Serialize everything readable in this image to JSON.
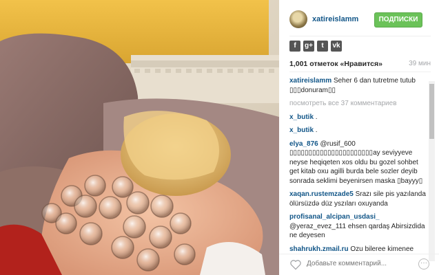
{
  "post": {
    "username": "xatireislamm",
    "follow_label": "ПОДПИСКИ",
    "likes_text": "1,001 отметок «Нравится»",
    "time_text": "39 мин",
    "view_all": "посмотреть все 37 комментариев",
    "add_comment_placeholder": "Добавьте комментарий...",
    "more_label": "···"
  },
  "share_icons": [
    {
      "name": "facebook-icon",
      "glyph": "f"
    },
    {
      "name": "google-plus-icon",
      "glyph": "g+"
    },
    {
      "name": "tumblr-icon",
      "glyph": "t"
    },
    {
      "name": "vk-icon",
      "glyph": "vk"
    }
  ],
  "caption": {
    "user": "xatireislamm",
    "text": "Seher 6 dan tutretme tutub ▯▯▯donuram▯▯"
  },
  "comments": [
    {
      "user": "x_butik",
      "text": "."
    },
    {
      "user": "x_butik",
      "text": "."
    },
    {
      "user": "elya_876",
      "text": "@rusif_600 ▯▯▯▯▯▯▯▯▯▯▯▯▯▯▯▯▯▯▯▯▯▯ay seviyyeve neyse heqiqeten xos oldu bu gozel sohbet get kitab oxu agilli burda bele sozler deyib sonrada seklimi beyenirsen maska ▯bayyy▯"
    },
    {
      "user": "xaqan.rustemzade5",
      "text": "Srazı sile pis yazılanda ölürsüzdə düz yszıları oxuyanda"
    },
    {
      "user": "profisanal_alcipan_usdasi_",
      "text": "@yeraz_evez_111 ehsen qardaş Abirsizdida ne deyesen"
    },
    {
      "user": "shahrukh.zmail.ru",
      "text": "Ozu bilereе kimenee qoyub eceb edib beden ozunundu ozu"
    }
  ],
  "colors": {
    "link": "#125688",
    "follow_bg": "#6bc259",
    "muted": "#a5a7aa"
  }
}
